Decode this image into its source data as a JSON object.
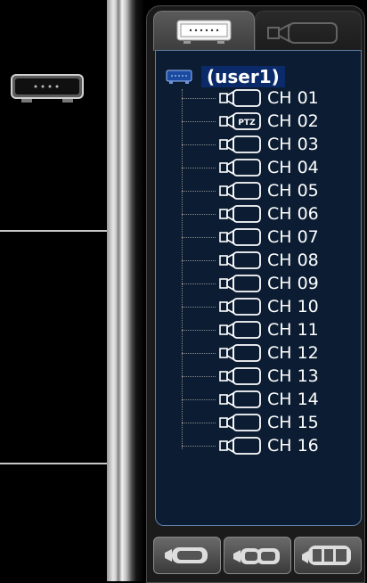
{
  "tree": {
    "root_label": "(user1)",
    "channels": [
      {
        "label": "CH 01",
        "icon": "camera-icon"
      },
      {
        "label": "CH 02",
        "icon": "ptz-camera-icon",
        "icon_text": "PTZ"
      },
      {
        "label": "CH 03",
        "icon": "camera-icon"
      },
      {
        "label": "CH 04",
        "icon": "camera-icon"
      },
      {
        "label": "CH 05",
        "icon": "camera-icon"
      },
      {
        "label": "CH 06",
        "icon": "camera-icon"
      },
      {
        "label": "CH 07",
        "icon": "camera-icon"
      },
      {
        "label": "CH 08",
        "icon": "camera-icon"
      },
      {
        "label": "CH 09",
        "icon": "camera-icon"
      },
      {
        "label": "CH 10",
        "icon": "camera-icon"
      },
      {
        "label": "CH 11",
        "icon": "camera-icon"
      },
      {
        "label": "CH 12",
        "icon": "camera-icon"
      },
      {
        "label": "CH 13",
        "icon": "camera-icon"
      },
      {
        "label": "CH 14",
        "icon": "camera-icon"
      },
      {
        "label": "CH 15",
        "icon": "camera-icon"
      },
      {
        "label": "CH 16",
        "icon": "camera-icon"
      }
    ]
  },
  "tabs": [
    {
      "name": "dvr-tab",
      "icon": "dvr-icon",
      "active": true
    },
    {
      "name": "camera-tab",
      "icon": "camera-icon",
      "active": false
    }
  ],
  "buttons": [
    {
      "name": "single-camera-button",
      "icon": "camera-group-icon"
    },
    {
      "name": "double-camera-button",
      "icon": "camera-group-icon"
    },
    {
      "name": "multi-camera-button",
      "icon": "camera-group-icon"
    }
  ],
  "colors": {
    "tree_bg": "#0c1d33",
    "root_highlight": "#0a2a6a",
    "text": "#ffffff"
  }
}
